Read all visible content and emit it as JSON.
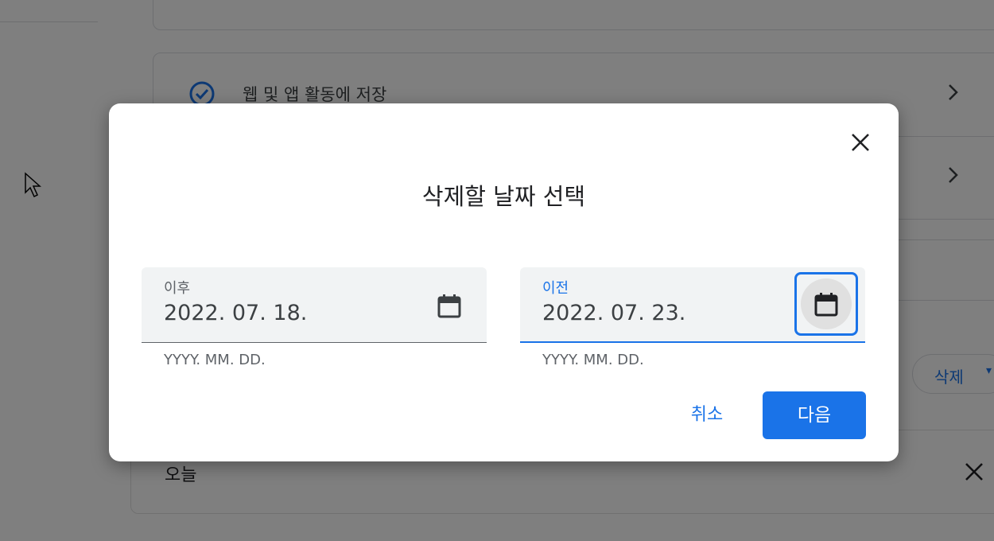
{
  "background": {
    "web_app_activity_label": "웹 및 앱 활동에 저장",
    "delete_chip": {
      "label": "삭제",
      "caret": "▾"
    },
    "today_label": "오늘"
  },
  "dialog": {
    "title": "삭제할 날짜 선택",
    "after_field": {
      "label": "이후",
      "value": "2022. 07. 18.",
      "helper": "YYYY. MM. DD."
    },
    "before_field": {
      "label": "이전",
      "value": "2022. 07. 23.",
      "helper": "YYYY. MM. DD."
    },
    "cancel_label": "취소",
    "next_label": "다음"
  },
  "icons": {
    "close": "close-icon",
    "calendar": "calendar-icon",
    "check": "check-circle-icon",
    "chevron": "chevron-right-icon",
    "cursor": "mouse-pointer-icon"
  },
  "colors": {
    "accent": "#1a73e8",
    "scrim": "rgba(0,0,0,0.5)"
  }
}
